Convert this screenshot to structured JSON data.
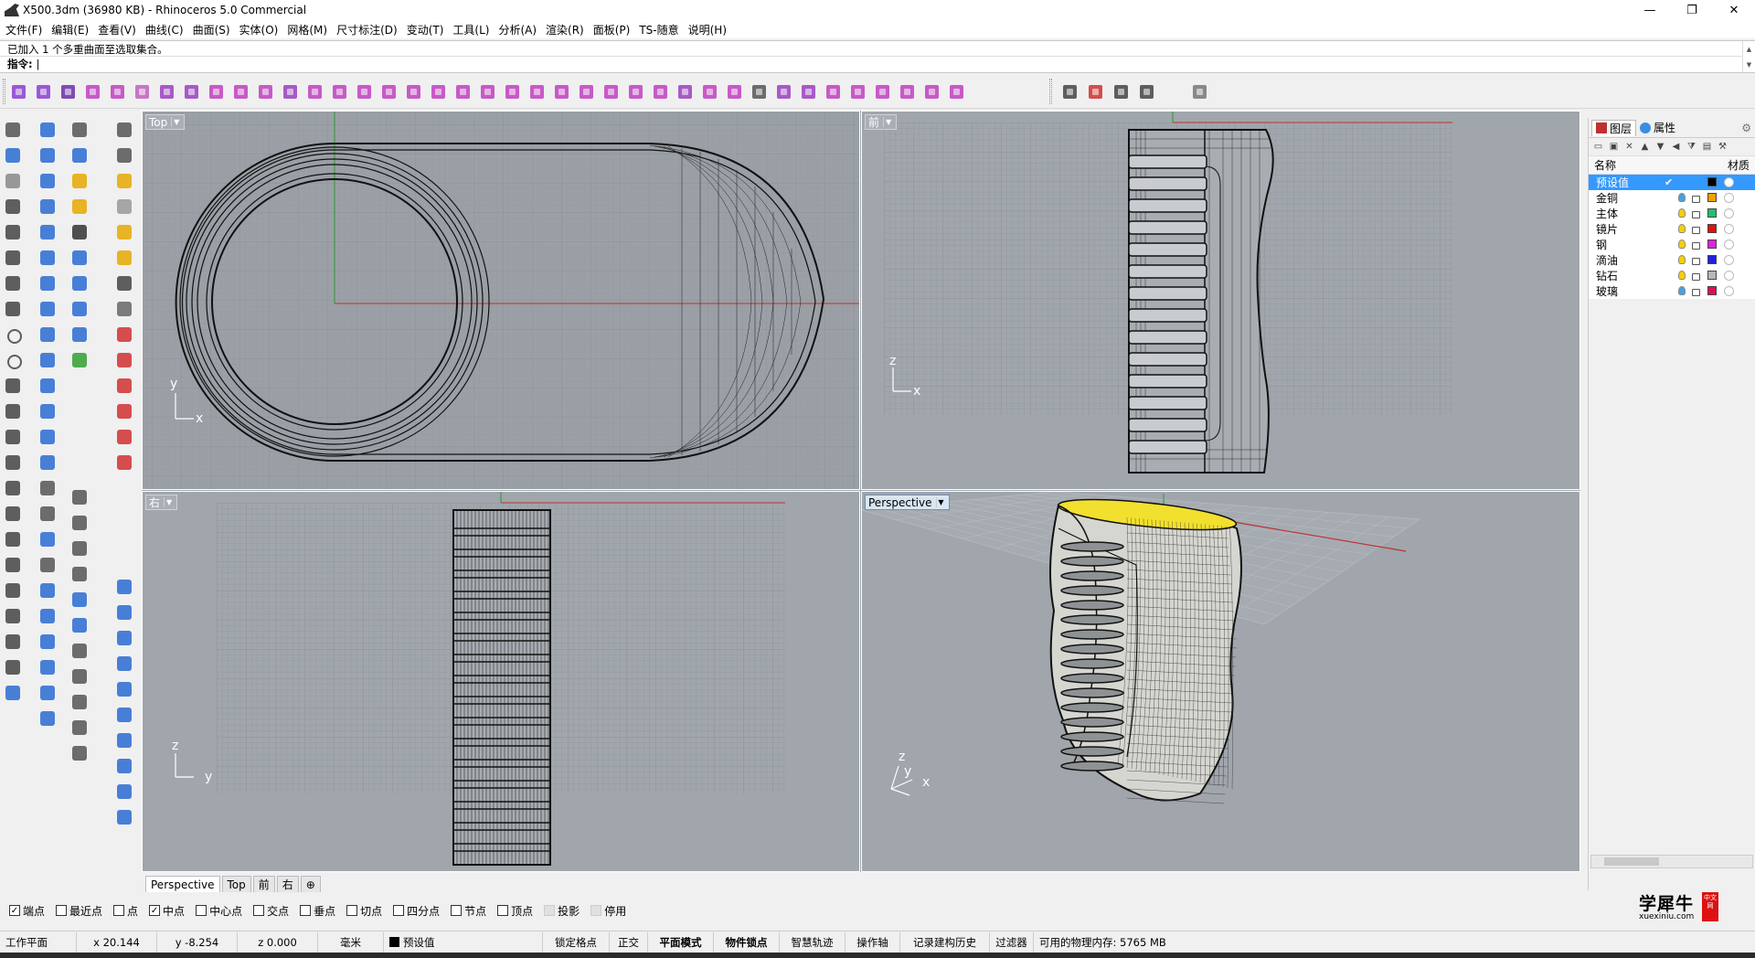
{
  "window": {
    "title": "X500.3dm (36980 KB) - Rhinoceros 5.0 Commercial",
    "minimize": "—",
    "restore": "❐",
    "close": "✕"
  },
  "menu": [
    "文件(F)",
    "编辑(E)",
    "查看(V)",
    "曲线(C)",
    "曲面(S)",
    "实体(O)",
    "网格(M)",
    "尺寸标注(D)",
    "变动(T)",
    "工具(L)",
    "分析(A)",
    "渲染(R)",
    "面板(P)",
    "TS-随意",
    "说明(H)"
  ],
  "command": {
    "history": "已加入 1 个多重曲面至选取集合。",
    "prompt": "指令:",
    "value": "|"
  },
  "viewports": {
    "top": {
      "label": "Top",
      "axis_a": "y",
      "axis_b": "x"
    },
    "front": {
      "label": "前",
      "axis_a": "z",
      "axis_b": "x"
    },
    "right": {
      "label": "右",
      "axis_a": "z",
      "axis_b": "y"
    },
    "perspective": {
      "label": "Perspective",
      "axis_a": "z",
      "axis_b": "y",
      "axis_c": "x"
    }
  },
  "view_tabs": [
    "Perspective",
    "Top",
    "前",
    "右",
    "⊕"
  ],
  "panel": {
    "tabs": {
      "layers": "图层",
      "properties": "属性"
    },
    "col_name": "名称",
    "col_material": "材质",
    "layers": [
      {
        "name": "预设值",
        "current": "✔",
        "color": "#000000",
        "selected": true
      },
      {
        "name": "金铜",
        "color": "#f5a000",
        "bulb": "blue"
      },
      {
        "name": "主体",
        "color": "#20c070",
        "bulb": "yellow"
      },
      {
        "name": "镜片",
        "color": "#e01010",
        "bulb": "yellow"
      },
      {
        "name": "钢",
        "color": "#e020e0",
        "bulb": "yellow"
      },
      {
        "name": "滴油",
        "color": "#2020e0",
        "bulb": "yellow"
      },
      {
        "name": "钻石",
        "color": "#b8b8b8",
        "bulb": "yellow"
      },
      {
        "name": "玻璃",
        "color": "#e01050",
        "bulb": "blue"
      }
    ]
  },
  "logo": {
    "main": "学犀牛",
    "sub": "xuexiniu.com",
    "badge": "中文网"
  },
  "osnaps": [
    {
      "label": "端点",
      "checked": true
    },
    {
      "label": "最近点",
      "checked": false
    },
    {
      "label": "点",
      "checked": false
    },
    {
      "label": "中点",
      "checked": true
    },
    {
      "label": "中心点",
      "checked": false
    },
    {
      "label": "交点",
      "checked": false
    },
    {
      "label": "垂点",
      "checked": false
    },
    {
      "label": "切点",
      "checked": false
    },
    {
      "label": "四分点",
      "checked": false
    },
    {
      "label": "节点",
      "checked": false
    },
    {
      "label": "顶点",
      "checked": false
    },
    {
      "label": "投影",
      "checked": false,
      "disabled": true
    },
    {
      "label": "停用",
      "checked": false,
      "disabled": true
    }
  ],
  "status": {
    "cplane": "工作平面",
    "x": "x 20.144",
    "y": "y -8.254",
    "z": "z 0.000",
    "units": "毫米",
    "layer": "预设值",
    "grid_snap": "锁定格点",
    "ortho": "正交",
    "planar": "平面模式",
    "osnap": "物件锁点",
    "smarttrack": "智慧轨迹",
    "gumball": "操作轴",
    "history": "记录建构历史",
    "filter": "过滤器",
    "memory": "可用的物理内存: 5765 MB"
  }
}
